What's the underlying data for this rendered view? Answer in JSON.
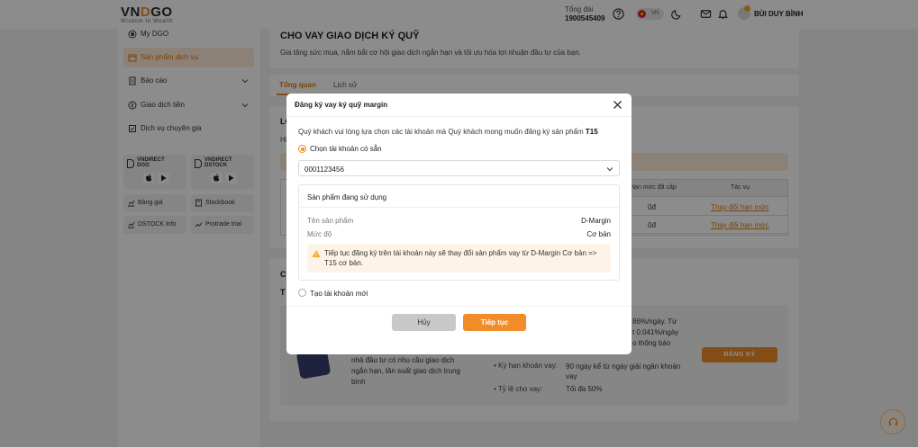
{
  "header": {
    "logo_main_a": "VN",
    "logo_main_o": "D",
    "logo_main_b": "GO",
    "logo_tagline": "Wisdom to Wealth",
    "hotline_label": "Tổng đài",
    "hotline_number": "1900545409",
    "lang": "VN",
    "user_name": "BÙI DUY BÌNH"
  },
  "sidebar": {
    "items": [
      {
        "label": "My DGO",
        "icon": "dgo-icon"
      },
      {
        "label": "Sản phẩm dịch vụ",
        "icon": "box-icon"
      },
      {
        "label": "Báo cáo",
        "icon": "report-icon"
      },
      {
        "label": "Giao dịch tiền",
        "icon": "money-icon"
      },
      {
        "label": "Dịch vụ chuyên gia",
        "icon": "expert-icon"
      }
    ],
    "apps": [
      {
        "line1": "VNDIRECT",
        "line2": "DGO"
      },
      {
        "line1": "VNDIRECT",
        "line2": "DSTOCK"
      }
    ],
    "tools": [
      {
        "label": "Bảng giá"
      },
      {
        "label": "Stockbook"
      },
      {
        "label": "DSTOCK Info"
      },
      {
        "label": "Protrade trial"
      }
    ]
  },
  "main": {
    "title": "CHO VAY GIAO DỊCH KÝ QUỸ",
    "subtitle": "Gia tăng sức mua, nắm bắt cơ hội giao dịch ngắn hạn và tối ưu hóa lợi nhuận đầu tư của bạn.",
    "tabs": [
      {
        "label": "Tổng quan"
      },
      {
        "label": "Lịch sử"
      }
    ],
    "section1_partial": "LO",
    "section1_hint_partial": "Hi",
    "table": {
      "headers": [
        "Hạn mức đã cấp",
        "Tác vụ"
      ],
      "rows": [
        {
          "limit": "0đ",
          "action": "Thay đổi hạn mức"
        },
        {
          "limit": "0đ",
          "action": "Thay đổi hạn mức"
        }
      ]
    },
    "section2_partial_a": "C",
    "section2_partial_b": "T",
    "info": {
      "right_text": [
        "86%/ngày. Từ",
        "t 0.041%/ngày",
        "o thông báo"
      ],
      "desc": [
        "nhà đầu tư có nhu cầu giao dịch",
        "ngắn hạn, tần suất giao dịch trung",
        "bình"
      ],
      "kv": [
        {
          "k": "Kỳ hạn khoản vay:",
          "v1": "90 ngày kể từ ngày giải ngân khoản",
          "v2": "vay"
        },
        {
          "k": "Tỷ lệ cho vay:",
          "v1": "Tối đa 50%",
          "v2": ""
        }
      ],
      "register_label": "ĐĂNG KÝ"
    }
  },
  "modal": {
    "title": "Đăng ký vay ký quỹ margin",
    "intro_prefix": "Quý khách vui lòng lựa chọn các tài khoản mà Quý khách mong muốn đăng ký sản phẩm ",
    "intro_product": "T15",
    "opt_existing": "Chọn tài khoản có sẵn",
    "account": "0001123456",
    "product_box_title": "Sản phẩm đang sử dụng",
    "rows": [
      {
        "k": "Tên sản phẩm",
        "v": "D-Margin"
      },
      {
        "k": "Mức độ",
        "v": "Cơ bản"
      }
    ],
    "warning": "Tiếp tục đăng ký trên tài khoản này sẽ thay đổi sản phẩm vay từ D-Margin Cơ bản => T15 cơ bản.",
    "opt_new": "Tạo tài khoản mới",
    "cancel": "Hủy",
    "next": "Tiếp tục"
  },
  "colors": {
    "accent": "#f28c28",
    "accent_dark": "#e07a10",
    "overlay": "rgba(0,0,0,0.45)"
  }
}
